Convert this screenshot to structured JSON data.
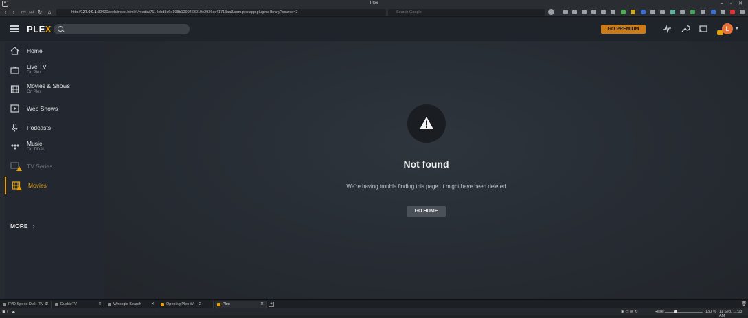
{
  "window": {
    "title": "Plex"
  },
  "browser": {
    "url_prefix": "http://",
    "url_host": "127.0.0.1",
    "url_rest": ":32400/web/index.html#!/media/7114ebd8c6e198b1299463019e2926cc41713aa3/com.plexapp.plugins.library?source=2",
    "search_placeholder": "Search Google"
  },
  "plex": {
    "brand_main": "PLE",
    "brand_x": "X",
    "premium_label": "GO PREMIUM",
    "avatar_initial": "L"
  },
  "sidebar": {
    "items": [
      {
        "label": "Home",
        "sub": ""
      },
      {
        "label": "Live TV",
        "sub": "On Plex"
      },
      {
        "label": "Movies & Shows",
        "sub": "On Plex"
      },
      {
        "label": "Web Shows",
        "sub": ""
      },
      {
        "label": "Podcasts",
        "sub": ""
      },
      {
        "label": "Music",
        "sub": "On TIDAL"
      },
      {
        "label": "TV Series",
        "sub": ""
      },
      {
        "label": "Movies",
        "sub": ""
      }
    ],
    "more_label": "MORE"
  },
  "error": {
    "title": "Not found",
    "message": "We're having trouble finding this page. It might have been deleted",
    "button": "GO HOME"
  },
  "tabs": [
    {
      "label": "FVD Speed Dial - TV S"
    },
    {
      "label": "DuckieTV"
    },
    {
      "label": "Whoogle Search"
    },
    {
      "label": "Opening Plex W:",
      "count": "2"
    },
    {
      "label": "Plex"
    }
  ],
  "status": {
    "reset_label": "Reset",
    "zoom": "130 %",
    "datetime": "11 Sep, 11:03 AM"
  },
  "colors": {
    "accent": "#e5a00d",
    "premium": "#cc7b19"
  }
}
